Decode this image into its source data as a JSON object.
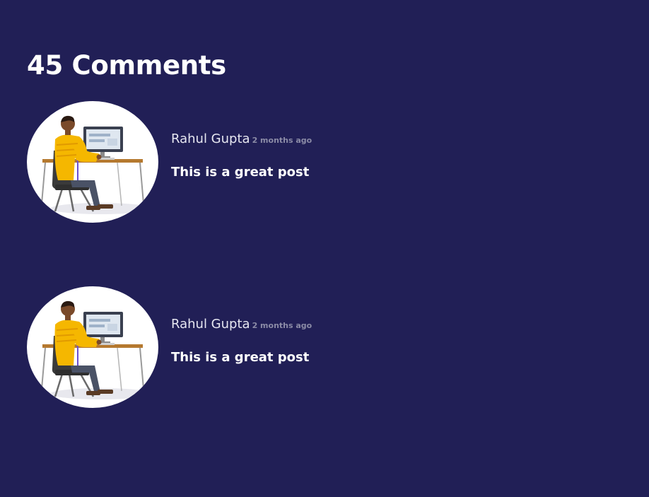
{
  "comments_section": {
    "heading": "45 Comments",
    "comments": [
      {
        "author": "Rahul Gupta",
        "time": "2 months ago",
        "text": "This is a great post",
        "avatar_icon": "person-at-desk-avatar-icon"
      },
      {
        "author": "Rahul Gupta",
        "time": "2 months ago",
        "text": "This is a great post",
        "avatar_icon": "person-at-desk-avatar-icon"
      }
    ]
  },
  "colors": {
    "background": "#211f56",
    "text": "#ffffff",
    "timestamp": "#8b8ba6"
  }
}
